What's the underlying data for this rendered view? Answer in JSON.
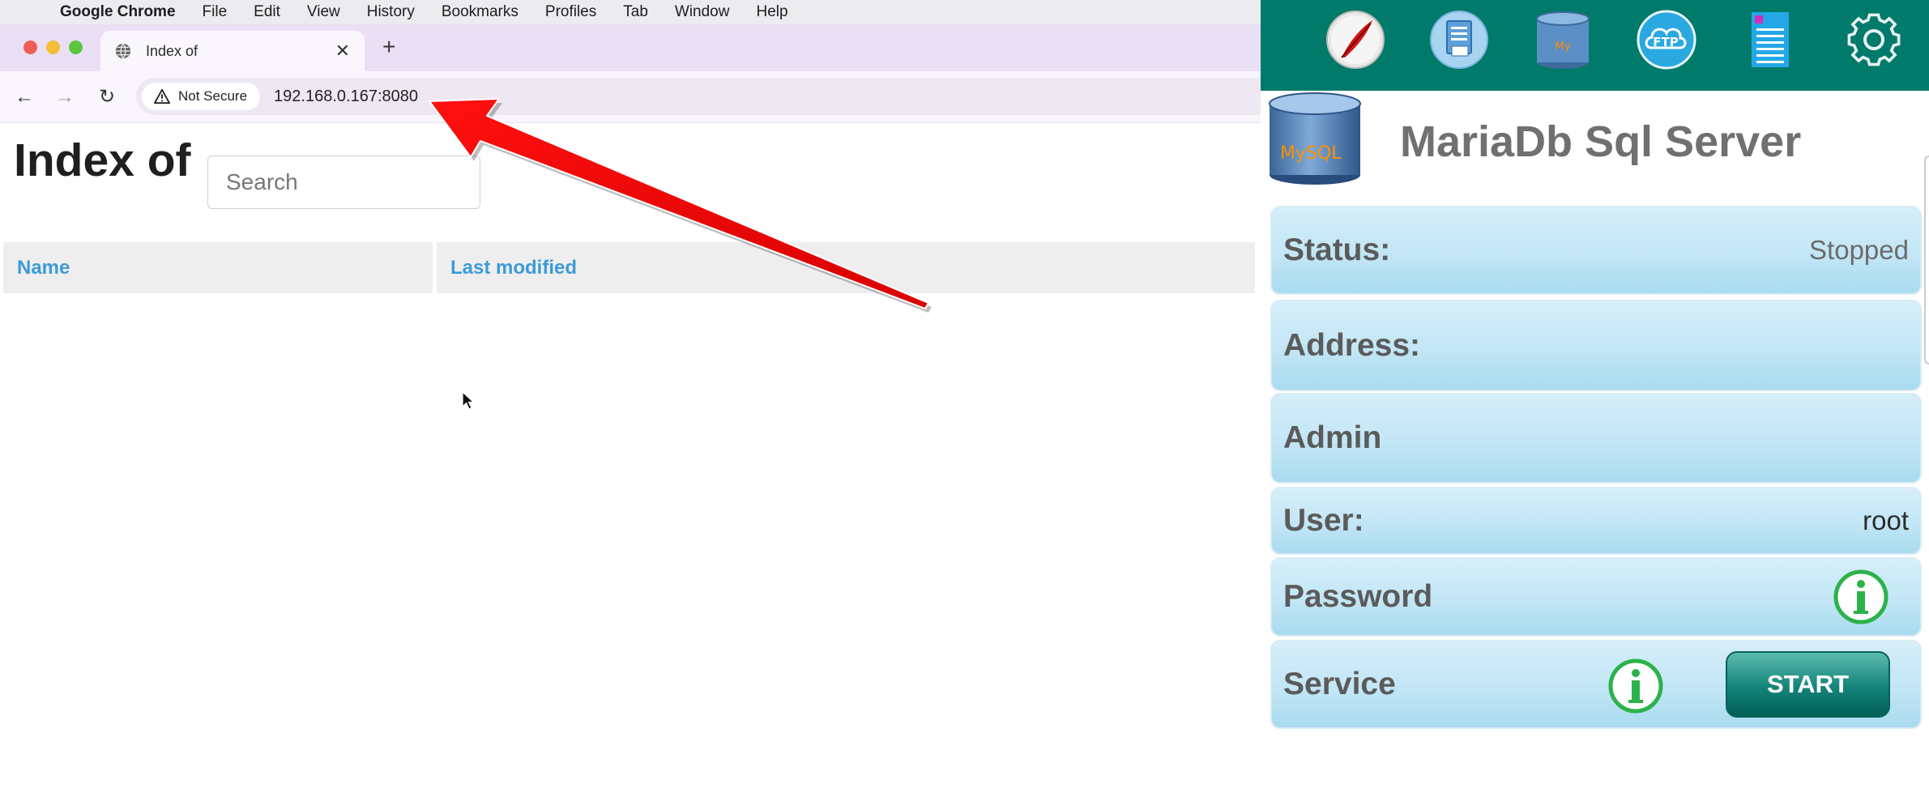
{
  "menubar": {
    "apple_glyph": "",
    "app_name": "Google Chrome",
    "items": [
      "File",
      "Edit",
      "View",
      "History",
      "Bookmarks",
      "Profiles",
      "Tab",
      "Window",
      "Help"
    ]
  },
  "browser": {
    "tab": {
      "title": "Index of",
      "close_glyph": "✕"
    },
    "new_tab_glyph": "+",
    "nav": {
      "back_glyph": "←",
      "forward_glyph": "→",
      "reload_glyph": "↻"
    },
    "security_label": "Not Secure",
    "url": "192.168.0.167:8080"
  },
  "page": {
    "title": "Index of",
    "search_placeholder": "Search",
    "table_headers": {
      "name": "Name",
      "last_modified": "Last modified"
    }
  },
  "app": {
    "toolbar_icons": [
      "feather-icon",
      "document-icon",
      "mysql-database-icon",
      "ftp-cloud-icon",
      "notes-icon",
      "settings-gear-icon"
    ],
    "ftp_label": "FTP",
    "logo_text": "MySQL",
    "title": "MariaDb Sql Server",
    "rows": {
      "status": {
        "label": "Status:",
        "value": "Stopped"
      },
      "address": {
        "label": "Address:",
        "value": ""
      },
      "admin": {
        "label": "Admin",
        "value": ""
      },
      "user": {
        "label": "User:",
        "value": "root"
      },
      "password": {
        "label": "Password"
      },
      "service": {
        "label": "Service",
        "button": "START"
      }
    },
    "colors": {
      "toolbar": "#007a6b",
      "info_green": "#2cb24a",
      "start_button": "#14847a"
    }
  },
  "annotation": {
    "color": "#ff0000"
  },
  "colors": {
    "link_blue": "#3d9bd6",
    "tabstrip": "#eadff5"
  }
}
